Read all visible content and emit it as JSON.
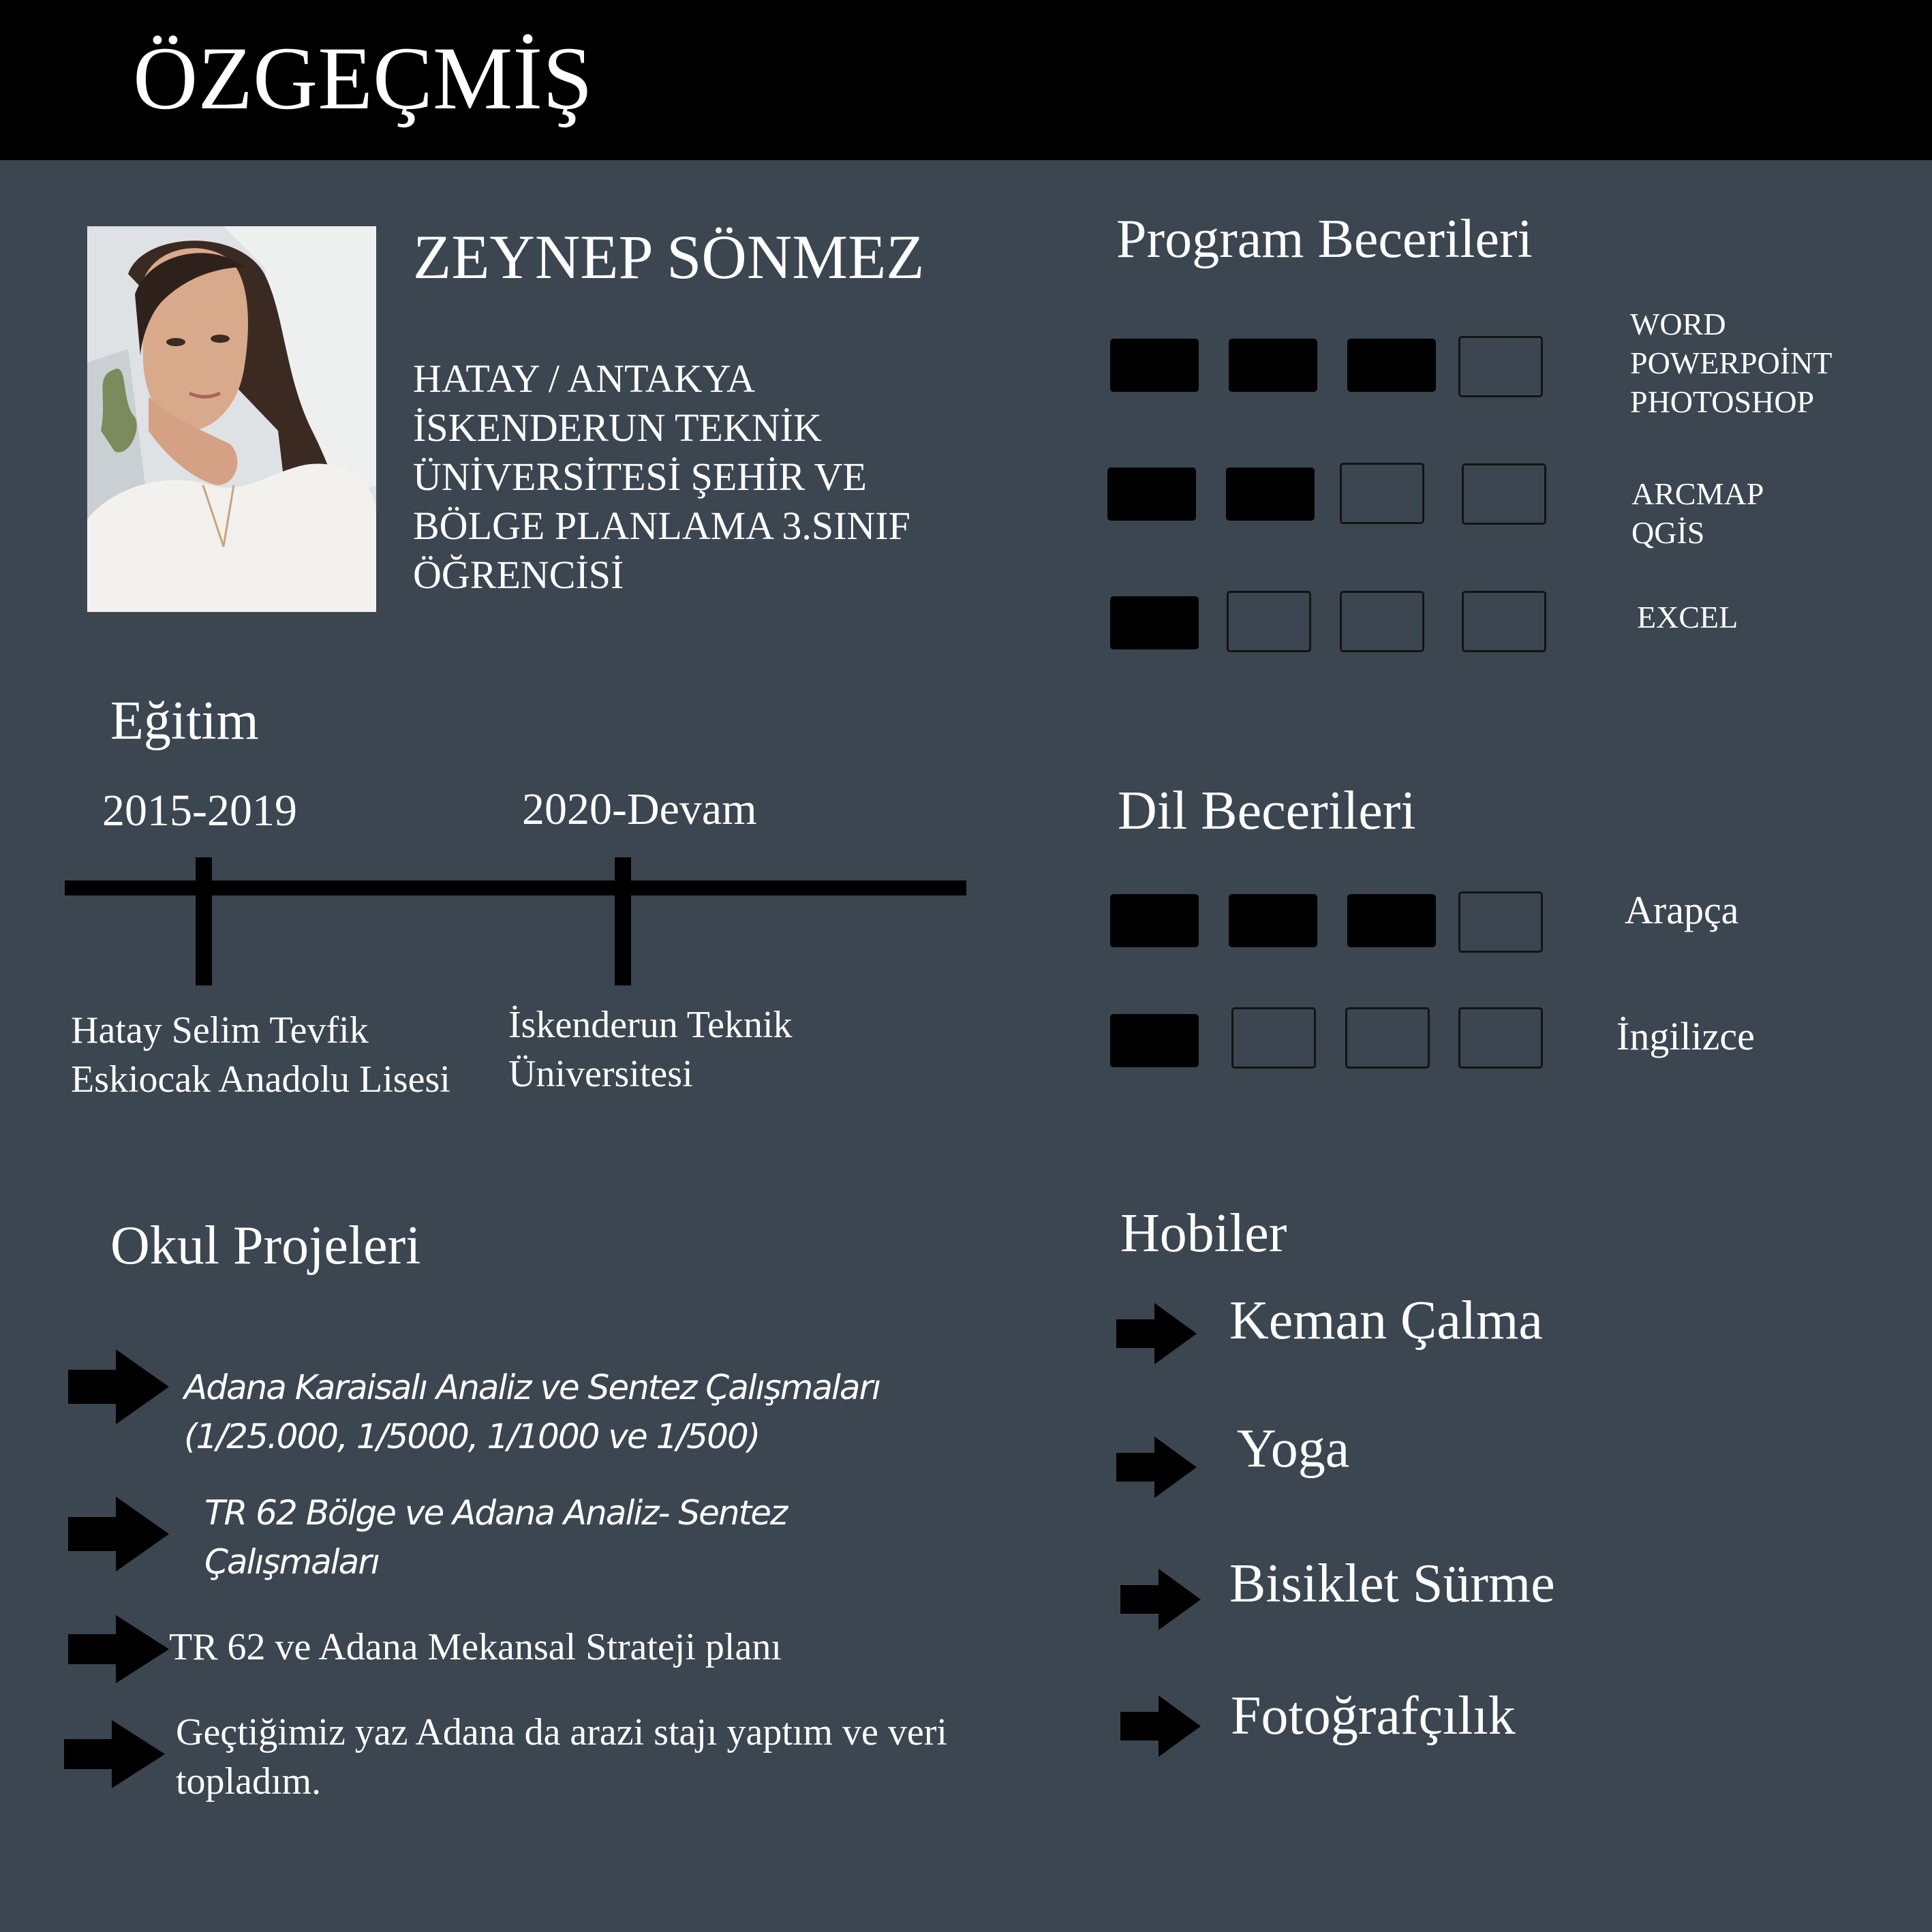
{
  "header": {
    "title": "ÖZGEÇMİŞ"
  },
  "profile": {
    "name": "ZEYNEP SÖNMEZ",
    "info_lines": [
      "HATAY / ANTAKYA",
      "İSKENDERUN TEKNİK",
      "ÜNİVERSİTESİ ŞEHİR VE",
      "BÖLGE PLANLAMA 3.SINIF",
      "ÖĞRENCİSİ"
    ]
  },
  "education": {
    "title": "Eğitim",
    "entries": [
      {
        "years": "2015-2019",
        "school_lines": [
          "Hatay Selim Tevfik",
          "Eskiocak Anadolu Lisesi"
        ]
      },
      {
        "years": "2020-Devam",
        "school_lines": [
          "İskenderun Teknik",
          "Üniversitesi"
        ]
      }
    ]
  },
  "projects": {
    "title": "Okul Projeleri",
    "items": [
      {
        "lines": [
          "Adana Karaisalı Analiz  ve Sentez Çalışmaları",
          "(1/25.000, 1/5000, 1/1000 ve 1/500)"
        ]
      },
      {
        "lines": [
          "TR 62  Bölge  ve Adana Analiz- Sentez",
          "Çalışmaları"
        ]
      },
      {
        "lines": [
          "TR 62 ve Adana Mekansal Strateji planı"
        ]
      },
      {
        "lines": [
          "Geçtiğimiz yaz Adana da arazi stajı yaptım ve veri",
          "topladım."
        ]
      }
    ]
  },
  "program_skills": {
    "title": "Program Becerileri",
    "rows": [
      {
        "level": 3,
        "max": 4,
        "labels": [
          "WORD",
          "POWERPOİNT",
          "PHOTOSHOP"
        ]
      },
      {
        "level": 2,
        "max": 4,
        "labels": [
          "ARCMAP",
          "QGİS"
        ]
      },
      {
        "level": 1,
        "max": 4,
        "labels": [
          "EXCEL"
        ]
      }
    ]
  },
  "language_skills": {
    "title": "Dil Becerileri",
    "rows": [
      {
        "level": 3,
        "max": 4,
        "label": "Arapça"
      },
      {
        "level": 1,
        "max": 4,
        "label": "İngilizce"
      }
    ]
  },
  "hobbies": {
    "title": "Hobiler",
    "items": [
      "Keman Çalma",
      "Yoga",
      "Bisiklet Sürme",
      "Fotoğrafçılık"
    ]
  },
  "colors": {
    "background": "#3b4650",
    "header": "#000000",
    "text": "#ffffff",
    "filled_box": "#000000"
  }
}
